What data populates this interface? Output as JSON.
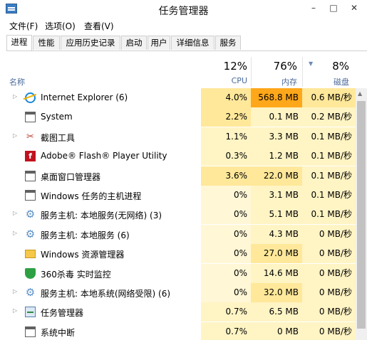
{
  "window": {
    "title": "任务管理器",
    "minimize": "–",
    "maximize": "□",
    "close": "✕"
  },
  "menu": {
    "file": "文件(F)",
    "options": "选项(O)",
    "view": "查看(V)"
  },
  "tabs": [
    "进程",
    "性能",
    "应用历史记录",
    "启动",
    "用户",
    "详细信息",
    "服务"
  ],
  "columns": {
    "name": "名称",
    "cpu": {
      "pct": "12%",
      "label": "CPU"
    },
    "memory": {
      "pct": "76%",
      "label": "内存"
    },
    "disk": {
      "pct": "8%",
      "label": "磁盘"
    }
  },
  "processes": [
    {
      "name": "Internet Explorer (6)",
      "cpu": "4.0%",
      "mem": "568.8 MB",
      "disk": "0.6 MB/秒",
      "icon": "ie-icon",
      "expandable": true
    },
    {
      "name": "System",
      "cpu": "2.2%",
      "mem": "0.1 MB",
      "disk": "0.2 MB/秒",
      "icon": "window-icon",
      "expandable": false
    },
    {
      "name": "截图工具",
      "cpu": "1.1%",
      "mem": "3.3 MB",
      "disk": "0.1 MB/秒",
      "icon": "scissors-icon",
      "expandable": true
    },
    {
      "name": "Adobe® Flash® Player Utility",
      "cpu": "0.3%",
      "mem": "1.2 MB",
      "disk": "0.1 MB/秒",
      "icon": "flash-icon",
      "expandable": false
    },
    {
      "name": "桌面窗口管理器",
      "cpu": "3.6%",
      "mem": "22.0 MB",
      "disk": "0.1 MB/秒",
      "icon": "window-icon",
      "expandable": false
    },
    {
      "name": "Windows 任务的主机进程",
      "cpu": "0%",
      "mem": "3.1 MB",
      "disk": "0.1 MB/秒",
      "icon": "window-icon",
      "expandable": false
    },
    {
      "name": "服务主机: 本地服务(无网络) (3)",
      "cpu": "0%",
      "mem": "5.1 MB",
      "disk": "0.1 MB/秒",
      "icon": "gear-icon",
      "expandable": true
    },
    {
      "name": "服务主机: 本地服务 (6)",
      "cpu": "0%",
      "mem": "4.3 MB",
      "disk": "0 MB/秒",
      "icon": "gear-icon",
      "expandable": true
    },
    {
      "name": "Windows 资源管理器",
      "cpu": "0%",
      "mem": "27.0 MB",
      "disk": "0 MB/秒",
      "icon": "folder-icon",
      "expandable": false
    },
    {
      "name": "360杀毒 实时监控",
      "cpu": "0%",
      "mem": "14.6 MB",
      "disk": "0 MB/秒",
      "icon": "shield-icon",
      "expandable": false
    },
    {
      "name": "服务主机: 本地系统(网络受限) (6)",
      "cpu": "0%",
      "mem": "32.0 MB",
      "disk": "0 MB/秒",
      "icon": "gear-icon",
      "expandable": true
    },
    {
      "name": "任务管理器",
      "cpu": "0.7%",
      "mem": "6.5 MB",
      "disk": "0 MB/秒",
      "icon": "taskmgr-icon",
      "expandable": true
    },
    {
      "name": "系统中断",
      "cpu": "0.7%",
      "mem": "0 MB",
      "disk": "0 MB/秒",
      "icon": "window-icon",
      "expandable": false
    }
  ],
  "colors": {
    "heat_low": "#fff4c4",
    "heat_mid": "#ffe89a",
    "heat_high": "#ffd65c",
    "heat_max": "#ffa71a"
  }
}
